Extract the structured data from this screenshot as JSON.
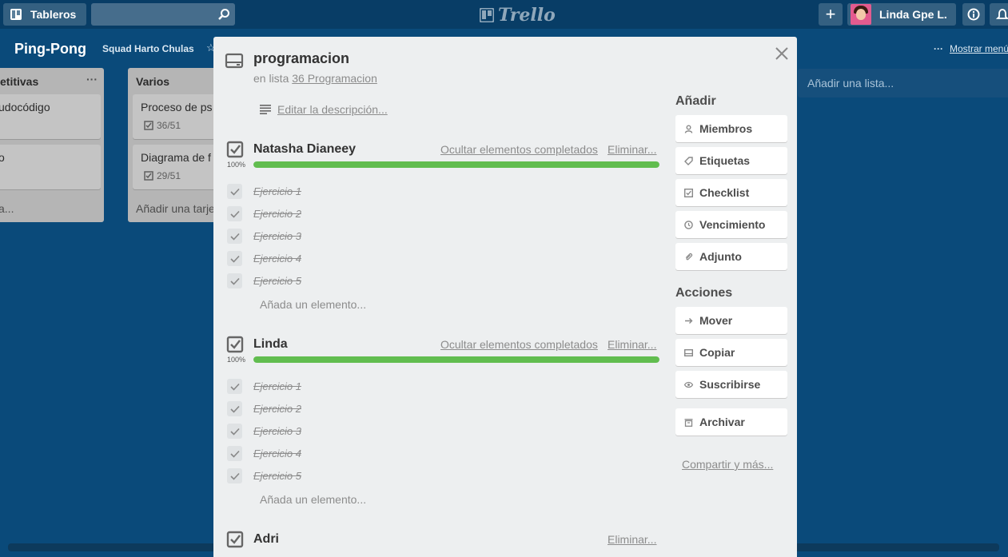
{
  "topbar": {
    "boards_label": "Tableros",
    "logo_text": "Trello",
    "user_name": "Linda Gpe L."
  },
  "board": {
    "title": "Ping-Pong",
    "team": "Squad Harto Chulas",
    "show_menu": "Mostrar menú",
    "add_list": "Añadir una lista..."
  },
  "lists": [
    {
      "title": "etitivas",
      "cards": [
        {
          "title": "udocódigo"
        },
        {
          "title": "o"
        }
      ],
      "add_card": "a..."
    },
    {
      "title": "Varios",
      "cards": [
        {
          "title": "Proceso de ps",
          "badge": "36/51"
        },
        {
          "title": "Diagrama de f",
          "badge": "29/51"
        }
      ],
      "add_card": "Añadir una tarje"
    }
  ],
  "card_modal": {
    "title": "programacion",
    "in_list_prefix": "en lista",
    "in_list_link": "36 Programacion",
    "edit_description": "Editar la descripción...",
    "checklists": [
      {
        "title": "Natasha Dianeey",
        "hide_completed": "Ocultar elementos completados",
        "delete": "Eliminar...",
        "percent_label": "100%",
        "progress": 1.0,
        "items": [
          "Ejercicio 1",
          "Ejercicio 2",
          "Ejercicio 3",
          "Ejercicio 4",
          "Ejercicio 5"
        ],
        "add_item": "Añada un elemento..."
      },
      {
        "title": "Linda",
        "hide_completed": "Ocultar elementos completados",
        "delete": "Eliminar...",
        "percent_label": "100%",
        "progress": 1.0,
        "items": [
          "Ejercicio 1",
          "Ejercicio 2",
          "Ejercicio 3",
          "Ejercicio 4",
          "Ejercicio 5"
        ],
        "add_item": "Añada un elemento..."
      },
      {
        "title": "Adri",
        "delete": "Eliminar..."
      }
    ]
  },
  "sidebar": {
    "add_heading": "Añadir",
    "add_buttons": [
      {
        "label": "Miembros",
        "icon": "person-icon"
      },
      {
        "label": "Etiquetas",
        "icon": "tag-icon"
      },
      {
        "label": "Checklist",
        "icon": "checkbox-icon"
      },
      {
        "label": "Vencimiento",
        "icon": "clock-icon"
      },
      {
        "label": "Adjunto",
        "icon": "paperclip-icon"
      }
    ],
    "actions_heading": "Acciones",
    "action_buttons": [
      {
        "label": "Mover",
        "icon": "arrow-right-icon"
      },
      {
        "label": "Copiar",
        "icon": "copy-icon"
      },
      {
        "label": "Suscribirse",
        "icon": "eye-icon"
      },
      {
        "label": "Archivar",
        "icon": "archive-icon"
      }
    ],
    "share": "Compartir y más..."
  },
  "colors": {
    "board_bg": "#0a4a7a",
    "header_bg": "#083d66",
    "progress_green": "#61bd4f",
    "modal_bg": "#edeff0"
  }
}
